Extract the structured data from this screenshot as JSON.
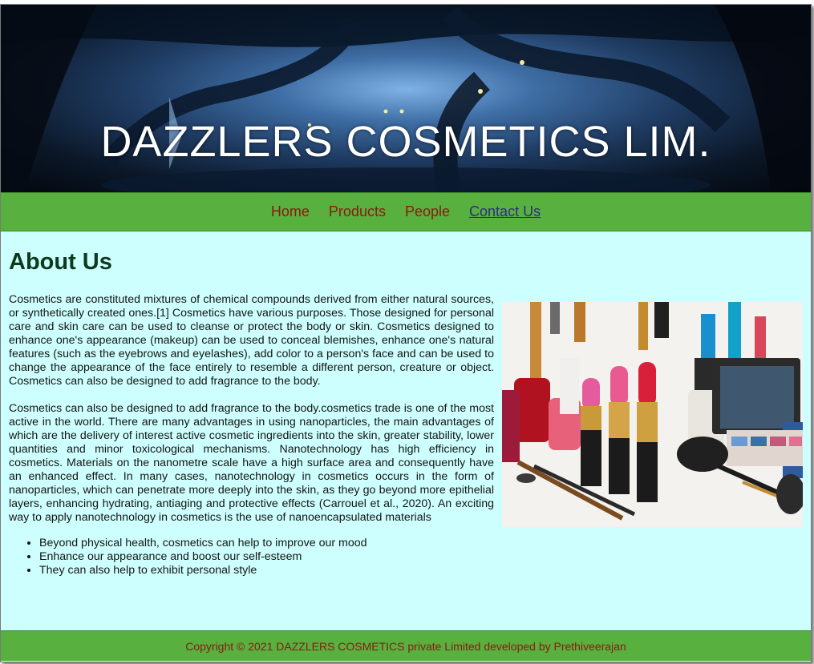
{
  "banner": {
    "title": "DAZZLERS COSMETICS LIM."
  },
  "nav": {
    "items": [
      {
        "label": "Home"
      },
      {
        "label": "Products"
      },
      {
        "label": "People"
      },
      {
        "label": "Contact Us"
      }
    ]
  },
  "main": {
    "heading": "About Us",
    "paragraph1": "Cosmetics are constituted mixtures of chemical compounds derived from either natural sources, or synthetically created ones.[1] Cosmetics have various purposes. Those designed for personal care and skin care can be used to cleanse or protect the body or skin. Cosmetics designed to enhance one's appearance (makeup) can be used to conceal blemishes, enhance one's natural features (such as the eyebrows and eyelashes), add color to a person's face and can be used to change the appearance of the face entirely to resemble a different person, creature or object. Cosmetics can also be designed to add fragrance to the body.",
    "paragraph2": "Cosmetics can also be designed to add fragrance to the body.cosmetics trade is one of the most active in the world. There are many advantages in using nanoparticles, the main advantages of which are the delivery of interest active cosmetic ingredients into the skin, greater stability, lower quantities and minor toxicological mechanisms. Nanotechnology has high efficiency in cosmetics. Materials on the nanometre scale have a high surface area and consequently have an enhanced effect. In many cases, nanotechnology in cosmetics occurs in the form of nanoparticles, which can penetrate more deeply into the skin, as they go beyond more epithelial layers, enhancing hydrating, antiaging and protective effects (Carrouel et al., 2020). An exciting way to apply nanotechnology in cosmetics is the use of nanoencapsulated materials",
    "bullets": [
      "Beyond physical health, cosmetics can help to improve our mood",
      "Enhance our appearance and boost our self-esteem",
      "They can also help to exhibit personal style"
    ]
  },
  "footer": {
    "text": "Copyright © 2021 DAZZLERS COSMETICS private Limited developed by Prethiveerajan"
  },
  "colors": {
    "nav_bg": "#58b03e",
    "content_bg": "#ccfffd",
    "link": "#8b1a10",
    "active_link": "#2f2a8a"
  }
}
